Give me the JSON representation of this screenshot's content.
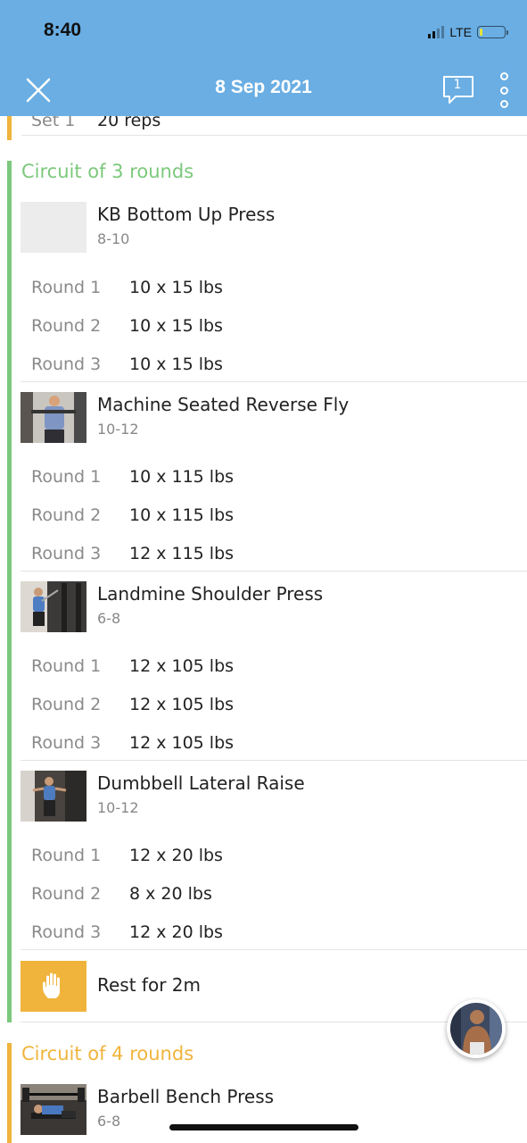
{
  "status": {
    "time": "8:40",
    "network": "LTE"
  },
  "nav": {
    "title": "8 Sep 2021",
    "comment_count": "1"
  },
  "previous": {
    "set_label": "Set 1",
    "value": "20 reps"
  },
  "circuit1": {
    "title": "Circuit of 3 rounds",
    "color": "#7cc87c",
    "exercises": [
      {
        "name": "KB Bottom Up Press",
        "reps": "8-10",
        "rounds": [
          {
            "label": "Round 1",
            "value": "10 x 15 lbs"
          },
          {
            "label": "Round 2",
            "value": "10 x 15 lbs"
          },
          {
            "label": "Round 3",
            "value": "10 x 15 lbs"
          }
        ]
      },
      {
        "name": "Machine Seated Reverse Fly",
        "reps": "10-12",
        "rounds": [
          {
            "label": "Round 1",
            "value": "10 x 115 lbs"
          },
          {
            "label": "Round 2",
            "value": "10 x 115 lbs"
          },
          {
            "label": "Round 3",
            "value": "12 x 115 lbs"
          }
        ]
      },
      {
        "name": "Landmine Shoulder Press",
        "reps": "6-8",
        "rounds": [
          {
            "label": "Round 1",
            "value": "12 x 105 lbs"
          },
          {
            "label": "Round 2",
            "value": "12 x 105 lbs"
          },
          {
            "label": "Round 3",
            "value": "12 x 105 lbs"
          }
        ]
      },
      {
        "name": "Dumbbell Lateral Raise",
        "reps": "10-12",
        "rounds": [
          {
            "label": "Round 1",
            "value": "12 x 20 lbs"
          },
          {
            "label": "Round 2",
            "value": "8 x 20 lbs"
          },
          {
            "label": "Round 3",
            "value": "12 x 20 lbs"
          }
        ]
      }
    ],
    "rest": "Rest for 2m"
  },
  "circuit2": {
    "title": "Circuit of 4 rounds",
    "color": "#f0b43c",
    "exercises": [
      {
        "name": "Barbell Bench Press",
        "reps": "6-8"
      }
    ]
  },
  "colors": {
    "header": "#6aaee3",
    "rest": "#f0b43c"
  },
  "icons": {
    "close": "close-icon",
    "comment": "comment-icon",
    "more": "more-icon",
    "rest": "hand-icon"
  }
}
